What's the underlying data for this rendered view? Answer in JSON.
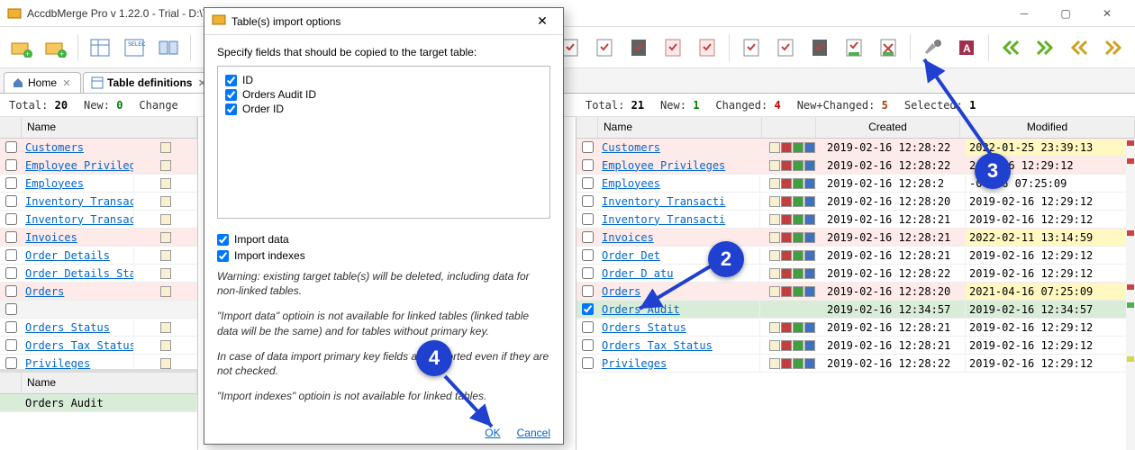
{
  "app": {
    "title": "AccdbMerge Pro v 1.22.0 - Trial - D:\\T"
  },
  "tabs": [
    {
      "label": "Home",
      "icon": "home-icon"
    },
    {
      "label": "Table definitions",
      "icon": "table-icon"
    }
  ],
  "left": {
    "stats": {
      "total_label": "Total:",
      "total": "20",
      "new_label": "New:",
      "new": "0",
      "changed_label": "Change"
    },
    "header": {
      "name": "Name"
    },
    "rows": [
      {
        "name": "Customers",
        "changed": true
      },
      {
        "name": "Employee Privileges",
        "changed": true
      },
      {
        "name": "Employees",
        "changed": false
      },
      {
        "name": "Inventory Transacti",
        "changed": false
      },
      {
        "name": "Inventory Transacti",
        "changed": false
      },
      {
        "name": "Invoices",
        "changed": true
      },
      {
        "name": "Order Details",
        "changed": false
      },
      {
        "name": "Order Details Statu",
        "changed": false
      },
      {
        "name": "Orders",
        "changed": true
      },
      {
        "name": "",
        "spacer": true
      },
      {
        "name": "Orders Status",
        "changed": false
      },
      {
        "name": "Orders Tax Status",
        "changed": false
      },
      {
        "name": "Privileges",
        "changed": false
      }
    ],
    "sub_header": {
      "name": "Name"
    },
    "sub_rows": [
      {
        "name": "Orders Audit",
        "selected": true
      }
    ]
  },
  "right": {
    "stats": {
      "total_label": "Total:",
      "total": "21",
      "new_label": "New:",
      "new": "1",
      "changed_label": "Changed:",
      "changed": "4",
      "nc_label": "New+Changed:",
      "nc": "5",
      "sel_label": "Selected:",
      "sel": "1"
    },
    "header": {
      "name": "Name",
      "created": "Created",
      "modified": "Modified"
    },
    "rows": [
      {
        "name": "Customers",
        "created": "2019-02-16 12:28:22",
        "modified": "2022-01-25 23:39:13",
        "changed": true,
        "mod_hl": true
      },
      {
        "name": "Employee Privileges",
        "created": "2019-02-16 12:28:22",
        "modified": "2-02-16 12:29:12",
        "changed": true
      },
      {
        "name": "Employees",
        "created": "2019-02-16 12:28:2",
        "modified": "-04-16 07:25:09",
        "changed": false
      },
      {
        "name": "Inventory Transacti",
        "created": "2019-02-16 12:28:20",
        "modified": "2019-02-16 12:29:12",
        "changed": false
      },
      {
        "name": "Inventory Transacti",
        "created": "2019-02-16 12:28:21",
        "modified": "2019-02-16 12:29:12",
        "changed": false
      },
      {
        "name": "Invoices",
        "created": "2019-02-16 12:28:21",
        "modified": "2022-02-11 13:14:59",
        "changed": true,
        "mod_hl": true
      },
      {
        "name": "Order Det",
        "created": "2019-02-16 12:28:21",
        "modified": "2019-02-16 12:29:12",
        "changed": false
      },
      {
        "name": "Order D      atu",
        "created": "2019-02-16 12:28:22",
        "modified": "2019-02-16 12:29:12",
        "changed": false
      },
      {
        "name": "Orders",
        "created": "2019-02-16 12:28:20",
        "modified": "2021-04-16 07:25:09",
        "changed": true,
        "mod_hl": true
      },
      {
        "name": "Orders Audit",
        "created": "2019-02-16 12:34:57",
        "modified": "2019-02-16 12:34:57",
        "selected": true,
        "checked": true
      },
      {
        "name": "Orders Status",
        "created": "2019-02-16 12:28:21",
        "modified": "2019-02-16 12:29:12",
        "changed": false
      },
      {
        "name": "Orders Tax Status",
        "created": "2019-02-16 12:28:21",
        "modified": "2019-02-16 12:29:12",
        "changed": false
      },
      {
        "name": "Privileges",
        "created": "2019-02-16 12:28:22",
        "modified": "2019-02-16 12:29:12",
        "changed": false
      }
    ]
  },
  "dialog": {
    "title": "Table(s) import options",
    "instruction": "Specify fields that should be copied to the target table:",
    "fields": [
      {
        "label": "ID",
        "checked": true
      },
      {
        "label": "Orders Audit ID",
        "checked": true
      },
      {
        "label": "Order ID",
        "checked": true
      }
    ],
    "import_data_label": "Import data",
    "import_indexes_label": "Import indexes",
    "warn1": "Warning: existing target table(s) will be deleted, including data for non-linked tables.",
    "warn2": "\"Import data\" optioin is not available for linked tables (linked table data will be the same) and for tables without primary key.",
    "warn3": "In case of data import primary key fields are imported even if they are not checked.",
    "warn4": "\"Import indexes\" optioin is not available for linked tables.",
    "ok": "OK",
    "cancel": "Cancel"
  },
  "callouts": {
    "c2": "2",
    "c3": "3",
    "c4": "4"
  }
}
